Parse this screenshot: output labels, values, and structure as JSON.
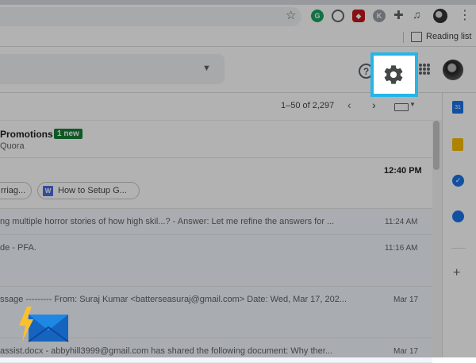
{
  "browser": {
    "bookmark_bar": {
      "reading_list_label": "Reading list"
    }
  },
  "gmail": {
    "pagination": {
      "range": "1–50 of 2,297"
    },
    "promotions": {
      "title": "Promotions",
      "badge": "1 new",
      "sender": "Quora"
    },
    "rows": [
      {
        "time": "12:40 PM",
        "chips": [
          "rriag...",
          "How to Setup G..."
        ]
      },
      {
        "snippet": "ng multiple horror stories of how high skil...? - Answer: Let me refine the answers for ...",
        "time": "11:24 AM"
      },
      {
        "snippet": "de - PFA.",
        "time": "11:16 AM"
      },
      {
        "snippet": "ssage --------- From: Suraj Kumar <batterseasuraj@gmail.com> Date: Wed, Mar 17, 202...",
        "time": "Mar 17"
      },
      {
        "snippet": "assist.docx - abbyhill3999@gmail.com has shared the following document: Why ther...",
        "time": "Mar 17"
      }
    ]
  },
  "colors": {
    "highlight": "#25b5e9",
    "badge_green": "#188038",
    "overlay": "rgba(0,0,0,0.3)"
  },
  "icons": [
    "star-icon",
    "grammarly-icon",
    "globe-icon",
    "ublock-icon",
    "k-extension-icon",
    "puzzle-icon",
    "media-icon",
    "profile-icon",
    "kebab-menu-icon",
    "reading-list-icon",
    "dropdown-caret-icon",
    "help-icon",
    "settings-gear-icon",
    "apps-grid-icon",
    "avatar",
    "chevron-left-icon",
    "chevron-right-icon",
    "keyboard-icon",
    "word-doc-icon",
    "calendar-icon",
    "keep-icon",
    "tasks-icon",
    "contacts-icon",
    "plus-icon",
    "brand-logo-icon"
  ]
}
